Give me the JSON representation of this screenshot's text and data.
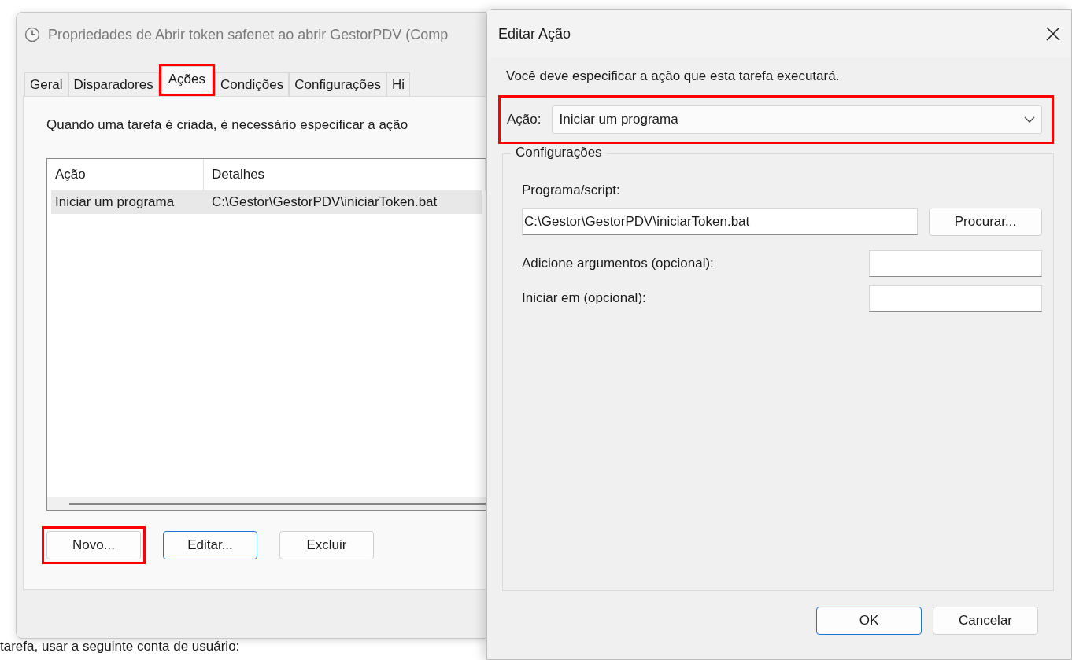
{
  "desktop": {
    "background_text": "tarefa, usar a seguinte conta de usuário:"
  },
  "properties_window": {
    "title": "Propriedades de Abrir token safenet ao abrir GestorPDV (Comp",
    "tabs": [
      {
        "label": "Geral",
        "selected": false,
        "highlighted": false
      },
      {
        "label": "Disparadores",
        "selected": false,
        "highlighted": false
      },
      {
        "label": "Ações",
        "selected": true,
        "highlighted": true
      },
      {
        "label": "Condições",
        "selected": false,
        "highlighted": false
      },
      {
        "label": "Configurações",
        "selected": false,
        "highlighted": false
      },
      {
        "label": "Hi",
        "selected": false,
        "highlighted": false
      }
    ],
    "description": "Quando uma tarefa é criada, é necessário especificar a ação",
    "table": {
      "columns": [
        "Ação",
        "Detalhes"
      ],
      "rows": [
        {
          "cells": [
            "Iniciar um programa",
            "C:\\Gestor\\GestorPDV\\iniciarToken.bat"
          ],
          "selected": true
        }
      ]
    },
    "buttons": [
      {
        "label": "Novo...",
        "default": false,
        "highlighted": true
      },
      {
        "label": "Editar...",
        "default": true,
        "highlighted": false
      },
      {
        "label": "Excluir",
        "default": false,
        "highlighted": false
      }
    ]
  },
  "edit_dialog": {
    "title": "Editar Ação",
    "prompt": "Você deve especificar a ação que esta tarefa executará.",
    "action": {
      "label": "Ação:",
      "value": "Iniciar um programa",
      "highlighted": true
    },
    "settings": {
      "legend": "Configurações",
      "browse_button": "Procurar...",
      "fields": [
        {
          "label": "Programa/script:",
          "value": "C:\\Gestor\\GestorPDV\\iniciarToken.bat",
          "kind": "wide"
        },
        {
          "label": "Adicione argumentos (opcional):",
          "kind": "inline"
        },
        {
          "label": "Iniciar em (opcional):",
          "kind": "inline"
        }
      ]
    },
    "buttons": [
      {
        "label": "OK",
        "default": true
      },
      {
        "label": "Cancelar",
        "default": false
      }
    ]
  }
}
